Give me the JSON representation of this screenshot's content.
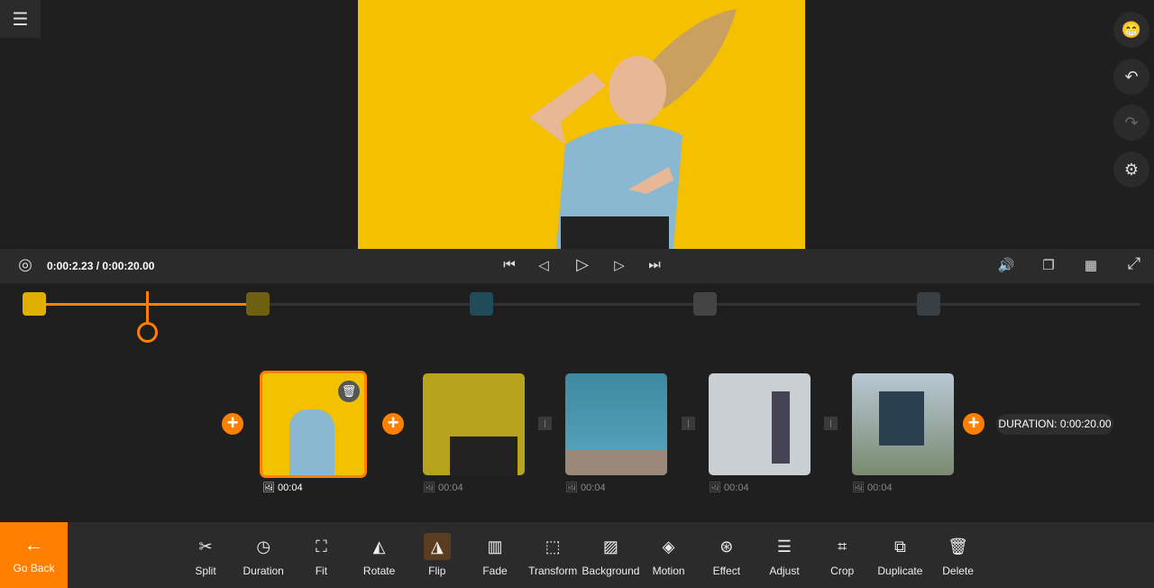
{
  "header": {
    "menu_icon": "hamburger-icon"
  },
  "side_buttons": [
    {
      "name": "emoji-button",
      "glyph": "😁"
    },
    {
      "name": "undo-button",
      "glyph": "↶"
    },
    {
      "name": "redo-button",
      "glyph": "↷"
    },
    {
      "name": "settings-button",
      "glyph": "⚙"
    }
  ],
  "player": {
    "time": "0:00:2.23 / 0:00:20.00",
    "progress": 0.11
  },
  "clips": [
    {
      "duration": "00:04",
      "selected": true,
      "color": "#f2c200"
    },
    {
      "duration": "00:04",
      "color": "#b8a41c"
    },
    {
      "duration": "00:04",
      "color": "#3c8aa0"
    },
    {
      "duration": "00:04",
      "color": "#c9cfd3"
    },
    {
      "duration": "00:04",
      "color": "#8a9aa8"
    }
  ],
  "total_duration": "DURATION: 0:00:20.00",
  "toolbar": {
    "go_back": "Go Back",
    "tools": [
      "Split",
      "Duration",
      "Fit",
      "Rotate",
      "Flip",
      "Fade",
      "Transform",
      "Background",
      "Motion",
      "Effect",
      "Adjust",
      "Crop",
      "Duplicate",
      "Delete"
    ],
    "active": "Flip"
  },
  "colors": {
    "accent": "#ff8000",
    "background": "#1f1f1f",
    "panel": "#2b2b2b"
  }
}
